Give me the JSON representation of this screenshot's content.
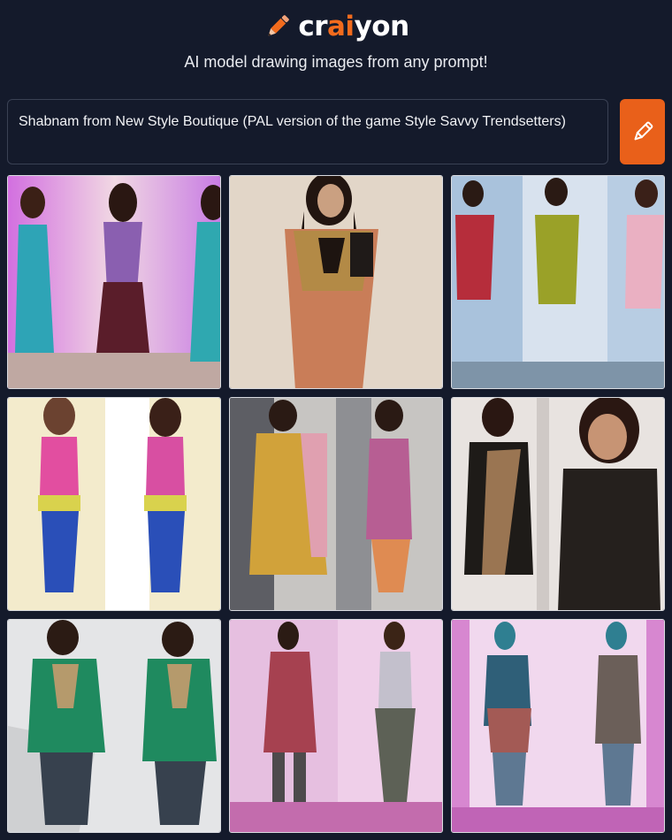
{
  "brand": {
    "prefix": "cr",
    "accent": "ai",
    "suffix": "yon",
    "accent_color": "#f26b1d"
  },
  "tagline": "AI model drawing images from any prompt!",
  "prompt": {
    "value": "Shabnam from New Style Boutique (PAL version of the game Style Savvy Trendsetters)"
  },
  "draw_button": {
    "icon": "pencil-icon",
    "color": "#e9601a"
  },
  "images": [
    {
      "description_icon": "generated-image",
      "bg": "#e8c6d9"
    },
    {
      "description_icon": "generated-image",
      "bg": "#d9d0c6"
    },
    {
      "description_icon": "generated-image",
      "bg": "#cfd9e6"
    },
    {
      "description_icon": "generated-image",
      "bg": "#f1e7c8"
    },
    {
      "description_icon": "generated-image",
      "bg": "#cfcfcf"
    },
    {
      "description_icon": "generated-image",
      "bg": "#ece8e6"
    },
    {
      "description_icon": "generated-image",
      "bg": "#d7d8da"
    },
    {
      "description_icon": "generated-image",
      "bg": "#dcb6d4"
    },
    {
      "description_icon": "generated-image",
      "bg": "#e0a9d8"
    }
  ]
}
